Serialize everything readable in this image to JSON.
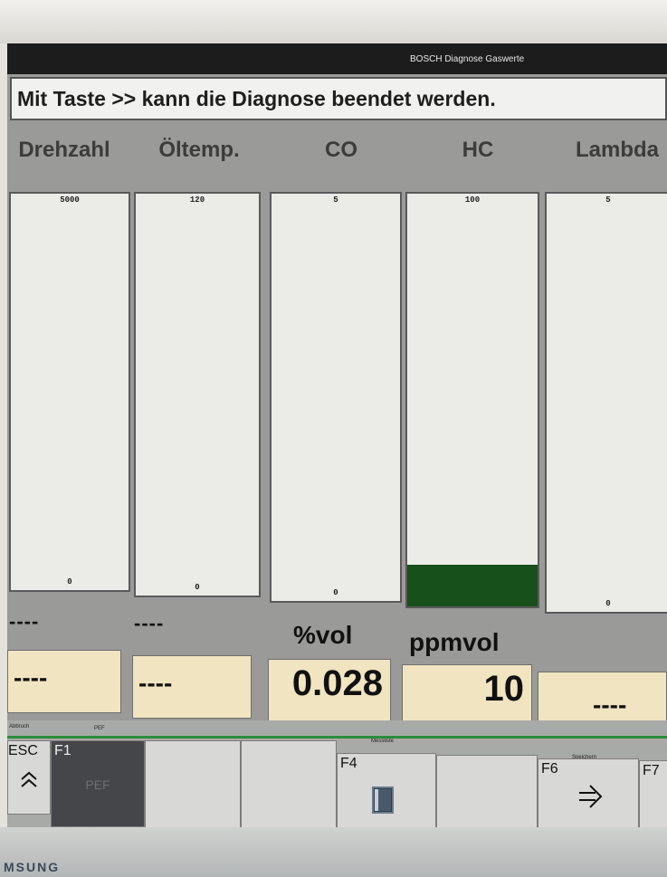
{
  "window": {
    "title": "BOSCH Diagnose Gaswerte"
  },
  "message": "Mit Taste >> kann die Diagnose beendet werden.",
  "columns": [
    {
      "header": "Drehzahl",
      "max": "5000",
      "min": "0",
      "fill_fraction": 0,
      "unit": "",
      "unit_dash": "----",
      "value": "----"
    },
    {
      "header": "Öltemp.",
      "max": "120",
      "min": "0",
      "fill_fraction": 0,
      "unit": "",
      "unit_dash": "----",
      "value": "----"
    },
    {
      "header": "CO",
      "max": "5",
      "min": "0",
      "fill_fraction": 0,
      "unit": "%vol",
      "unit_dash": "",
      "value": "0.028"
    },
    {
      "header": "HC",
      "max": "100",
      "min": "0",
      "fill_fraction": 0.1,
      "unit": "ppmvol",
      "unit_dash": "",
      "value": "10"
    },
    {
      "header": "Lambda",
      "max": "5",
      "min": "0",
      "fill_fraction": 0,
      "unit": "",
      "unit_dash": "",
      "value": "----"
    }
  ],
  "colors": {
    "bar_fill": "#17501b",
    "value_box": "#f1e4c0",
    "softkey_line": "#2b8c3a"
  },
  "softkeys": {
    "labels": {
      "esc": "Abbruch",
      "f1": "PEF",
      "f4": "Messliste",
      "f6": "Speichern"
    },
    "keys": [
      {
        "name": "ESC",
        "caption": "",
        "icon": "double-chevron-up-icon"
      },
      {
        "name": "F1",
        "caption": "PEF",
        "icon": ""
      },
      {
        "name": "",
        "caption": "",
        "icon": ""
      },
      {
        "name": "",
        "caption": "",
        "icon": ""
      },
      {
        "name": "F4",
        "caption": "",
        "icon": "list-icon"
      },
      {
        "name": "",
        "caption": "",
        "icon": ""
      },
      {
        "name": "F6",
        "caption": "",
        "icon": "save-arrow-icon"
      },
      {
        "name": "F7",
        "caption": "",
        "icon": ""
      }
    ]
  },
  "bezel": {
    "brand": "MSUNG"
  }
}
